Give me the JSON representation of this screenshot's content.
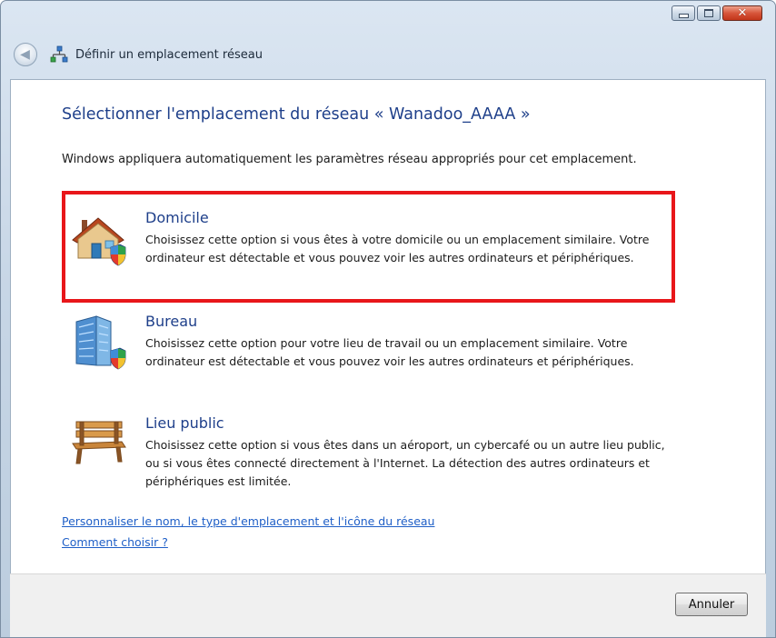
{
  "window": {
    "minimize_label": "Réduire",
    "maximize_label": "Agrandir",
    "close_label": "Fermer"
  },
  "navbar": {
    "title": "Définir un emplacement réseau"
  },
  "main": {
    "heading": "Sélectionner l'emplacement du réseau « Wanadoo_AAAA »",
    "intro": "Windows appliquera automatiquement les paramètres réseau appropriés pour cet emplacement.",
    "options": [
      {
        "title": "Domicile",
        "icon": "house-icon",
        "description": "Choisissez cette option si vous êtes à votre domicile ou un emplacement similaire. Votre ordinateur est détectable et vous pouvez voir les autres ordinateurs et périphériques."
      },
      {
        "title": "Bureau",
        "icon": "office-building-icon",
        "description": "Choisissez cette option pour votre lieu de travail ou un emplacement similaire. Votre ordinateur est détectable et vous pouvez voir les autres ordinateurs et périphériques."
      },
      {
        "title": "Lieu public",
        "icon": "park-bench-icon",
        "description": "Choisissez cette option si vous êtes dans un aéroport, un cybercafé ou un autre lieu public, ou si vous êtes connecté directement à l'Internet. La détection des autres ordinateurs et périphériques est limitée."
      }
    ],
    "links": {
      "customize": "Personnaliser le nom, le type d'emplacement et l'icône du réseau",
      "how_to_choose": "Comment choisir ?"
    }
  },
  "footer": {
    "cancel_label": "Annuler"
  },
  "colors": {
    "highlight": "#e8161a",
    "heading": "#1e3f8a",
    "link": "#1f5fc7"
  }
}
